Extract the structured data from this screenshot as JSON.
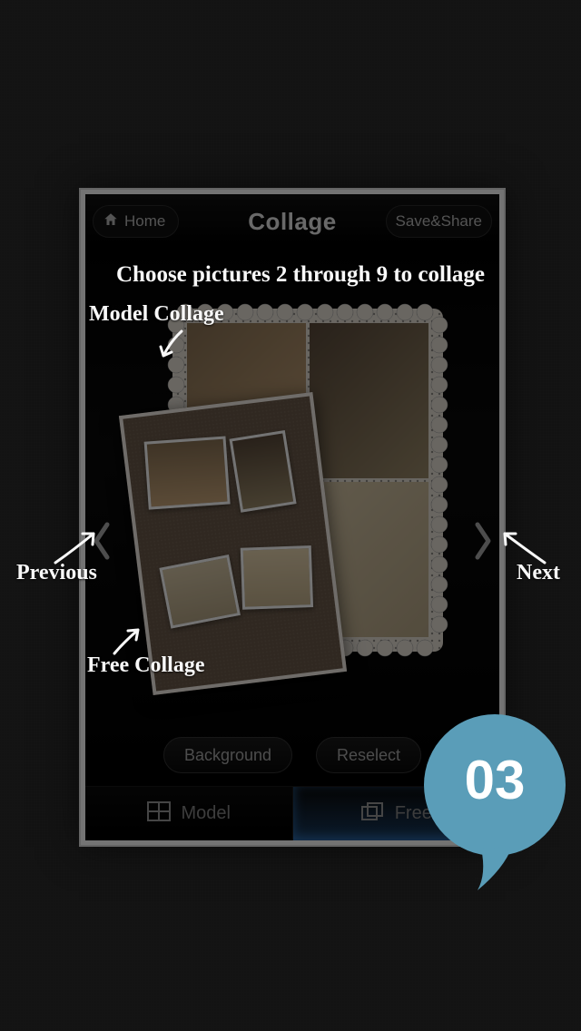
{
  "header": {
    "home_label": "Home",
    "title": "Collage",
    "save_label": "Save&Share"
  },
  "instruction": "Choose pictures 2 through 9 to collage",
  "annotations": {
    "model_collage": "Model Collage",
    "free_collage": "Free Collage",
    "previous": "Previous",
    "next": "Next"
  },
  "actions": {
    "background": "Background",
    "reselect": "Reselect"
  },
  "tabs": {
    "model": "Model",
    "free": "Free"
  },
  "badge": {
    "number": "03"
  },
  "colors": {
    "accent": "#5a9db8",
    "text_overlay": "#f8f8f8"
  }
}
